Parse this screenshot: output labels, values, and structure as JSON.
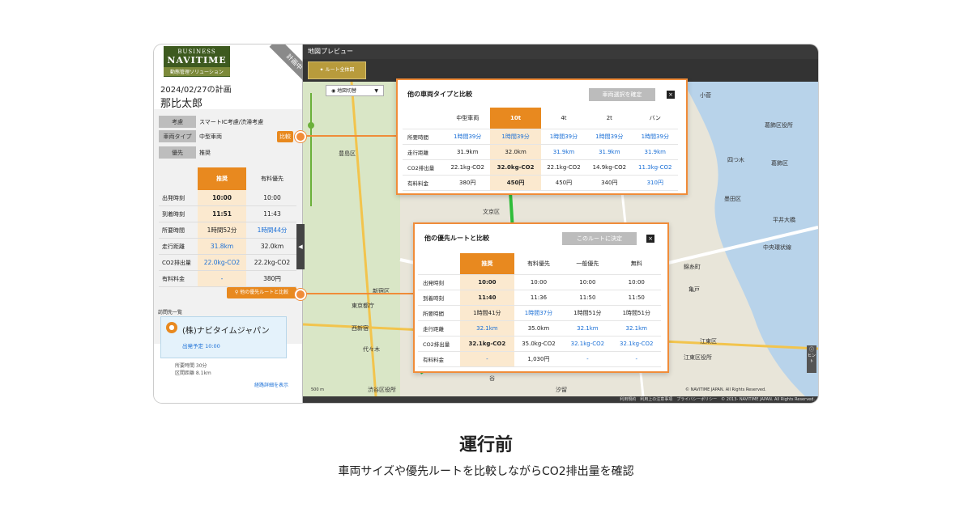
{
  "sidebar": {
    "logo": {
      "line1": "BUSINESS",
      "line2": "NAVITIME",
      "line3": "動態管理ソリューション"
    },
    "ribbon": "計画中",
    "plan_date": "2024/02/27の計画",
    "person": "那比太郎",
    "conditions": [
      {
        "key": "考慮",
        "value": "スマートIC考慮/渋滞考慮"
      },
      {
        "key": "車両タイプ",
        "value": "中型車両"
      },
      {
        "key": "優先",
        "value": "推奨"
      }
    ],
    "compare_button": "比較",
    "route_table": {
      "headers": [
        "推奨",
        "有料優先"
      ],
      "rows": [
        {
          "key": "出発時刻",
          "a": "10:00",
          "b": "10:00"
        },
        {
          "key": "到着時刻",
          "a": "11:51",
          "b": "11:43"
        },
        {
          "key": "所要時間",
          "a": "1時間52分",
          "b": "1時間44分"
        },
        {
          "key": "走行距離",
          "a": "31.8km",
          "b": "32.0km"
        },
        {
          "key": "CO2排出量",
          "a": "22.0kg-CO2",
          "b": "22.2kg-CO2"
        },
        {
          "key": "有料料金",
          "a": "-",
          "b": "380円"
        }
      ]
    },
    "other_route_button": "他の優先ルートと比較",
    "dest_label": "訪問先一覧",
    "dest_name": "(株)ナビタイムジャパン",
    "dest_sub": "出発予定 10:00",
    "dest_meta": [
      "所要時間 30分",
      "区間距離 8.1km"
    ],
    "detail_link": "経路詳細を表示"
  },
  "map": {
    "title": "地図プレビュー",
    "route_overview": "ルート全体図",
    "map_switch": "地図切替",
    "footer": "利用規約　利用上の注意事項　プライバシーポリシー　© 2013- NAVITIME JAPAN. All Rights Reserved.",
    "hint": "ヒント",
    "scale": "500 m",
    "copyright": "© NAVITIME JAPAN. All Rights Reserved.",
    "labels": [
      "豊島区",
      "文京区",
      "新宿区",
      "東京都庁",
      "西新宿",
      "代々木",
      "渋谷区役所",
      "小菅",
      "葛飾区役所",
      "四つ木",
      "葛飾区",
      "墨田区",
      "平井大橋",
      "中央環状線",
      "江東区",
      "江東区役所",
      "亀戸",
      "錦糸町",
      "浅草",
      "谷",
      "汐留"
    ]
  },
  "vehicle_popup": {
    "title": "他の車両タイプと比較",
    "confirm": "車両選択を確定",
    "close": "×",
    "headers": [
      "中型車両",
      "10t",
      "4t",
      "2t",
      "バン"
    ],
    "rows": [
      {
        "key": "所要時間",
        "cells": [
          "1時間39分",
          "1時間39分",
          "1時間39分",
          "1時間39分",
          "1時間39分"
        ]
      },
      {
        "key": "走行距離",
        "cells": [
          "31.9km",
          "32.0km",
          "31.9km",
          "31.9km",
          "31.9km"
        ]
      },
      {
        "key": "CO2排出量",
        "cells": [
          "22.1kg-CO2",
          "32.0kg-CO2",
          "22.1kg-CO2",
          "14.9kg-CO2",
          "11.3kg-CO2"
        ]
      },
      {
        "key": "有料料金",
        "cells": [
          "380円",
          "450円",
          "450円",
          "340円",
          "310円"
        ]
      }
    ]
  },
  "priority_popup": {
    "title": "他の優先ルートと比較",
    "confirm": "このルートに決定",
    "close": "×",
    "headers": [
      "推奨",
      "有料優先",
      "一般優先",
      "無料"
    ],
    "rows": [
      {
        "key": "出発時刻",
        "cells": [
          "10:00",
          "10:00",
          "10:00",
          "10:00"
        ]
      },
      {
        "key": "到着時刻",
        "cells": [
          "11:40",
          "11:36",
          "11:50",
          "11:50"
        ]
      },
      {
        "key": "所要時間",
        "cells": [
          "1時間41分",
          "1時間37分",
          "1時間51分",
          "1時間51分"
        ]
      },
      {
        "key": "走行距離",
        "cells": [
          "32.1km",
          "35.0km",
          "32.1km",
          "32.1km"
        ]
      },
      {
        "key": "CO2排出量",
        "cells": [
          "32.1kg-CO2",
          "35.0kg-CO2",
          "32.1kg-CO2",
          "32.1kg-CO2"
        ]
      },
      {
        "key": "有料料金",
        "cells": [
          "-",
          "1,030円",
          "-",
          "-"
        ]
      }
    ]
  },
  "caption": {
    "headline": "運行前",
    "subline": "車両サイズや優先ルートを比較しながらCO2排出量を確認"
  },
  "colors": {
    "accent": "#e8891f",
    "popup_border": "#f08c39",
    "link": "#1a6fd6"
  }
}
